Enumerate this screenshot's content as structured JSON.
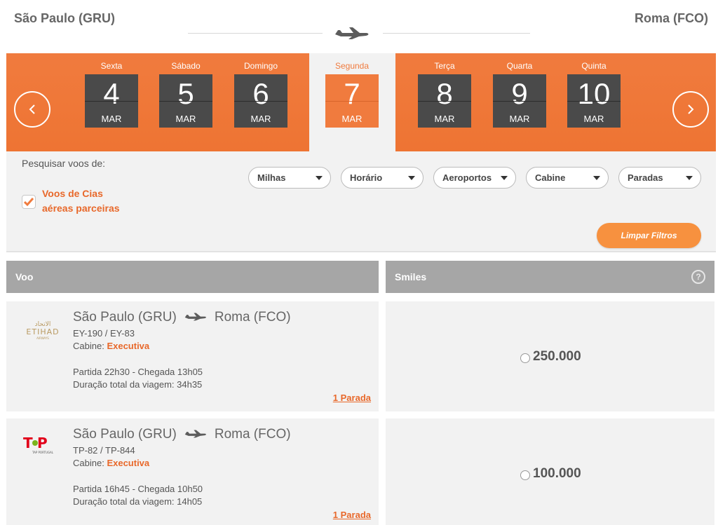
{
  "route": {
    "origin": "São Paulo (GRU)",
    "destination": "Roma (FCO)"
  },
  "dates": [
    {
      "weekday": "Sexta",
      "day": "4",
      "month": "MAR"
    },
    {
      "weekday": "Sábado",
      "day": "5",
      "month": "MAR"
    },
    {
      "weekday": "Domingo",
      "day": "6",
      "month": "MAR"
    },
    {
      "weekday": "Segunda",
      "day": "7",
      "month": "MAR",
      "selected": true
    },
    {
      "weekday": "Terça",
      "day": "8",
      "month": "MAR"
    },
    {
      "weekday": "Quarta",
      "day": "9",
      "month": "MAR"
    },
    {
      "weekday": "Quinta",
      "day": "10",
      "month": "MAR"
    }
  ],
  "filters": {
    "search_label": "Pesquisar voos de:",
    "partner_label": "Voos de Cias aéreas parceiras",
    "partner_checked": true,
    "dropdowns": [
      "Milhas",
      "Horário",
      "Aeroportos",
      "Cabine",
      "Paradas"
    ],
    "clear_label": "Limpar Filtros"
  },
  "table": {
    "col_flight": "Voo",
    "col_smiles": "Smiles",
    "help_symbol": "?"
  },
  "flights": [
    {
      "airline_logo": "etihad-logo",
      "origin": "São Paulo (GRU)",
      "destination": "Roma (FCO)",
      "codes": "EY-190 / EY-83",
      "cabin_label": "Cabine:",
      "cabin": "Executiva",
      "times": "Partida 22h30 - Chegada 13h05",
      "duration": "Duração total da viagem: 34h35",
      "stops": "1 Parada",
      "smiles": "250.000"
    },
    {
      "airline_logo": "tap-portugal-logo",
      "origin": "São Paulo (GRU)",
      "destination": "Roma (FCO)",
      "codes": "TP-82 / TP-844",
      "cabin_label": "Cabine:",
      "cabin": "Executiva",
      "times": "Partida 16h45 - Chegada 10h50",
      "duration": "Duração total da viagem: 14h05",
      "stops": "1 Parada",
      "smiles": "100.000"
    }
  ],
  "colors": {
    "accent": "#f07b3e",
    "card": "#4a4a4a",
    "panel": "#f2f2f2",
    "header": "#a6a6a6"
  }
}
